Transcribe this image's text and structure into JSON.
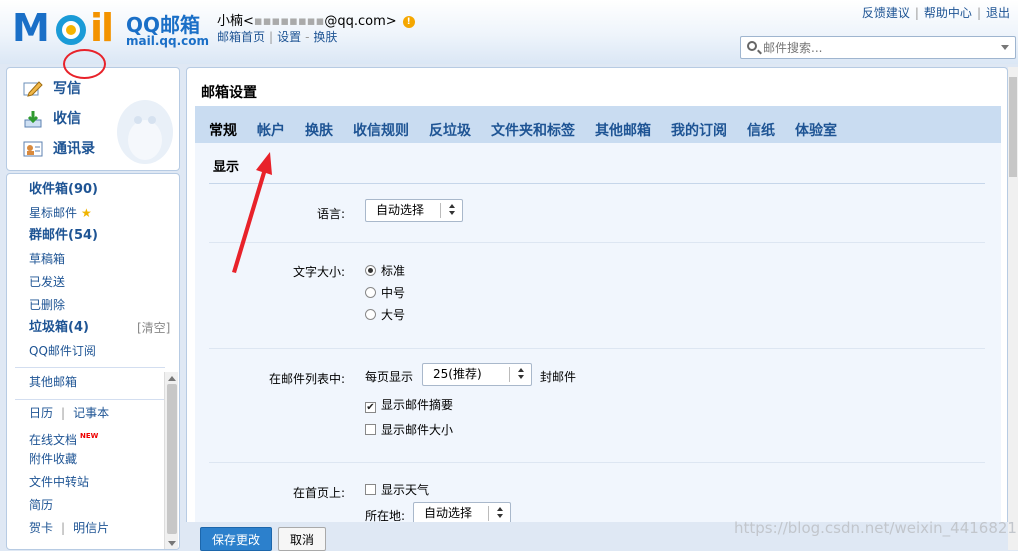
{
  "header": {
    "logo_cn": "QQ邮箱",
    "logo_url": "mail.qq.com",
    "user_name": "小楠<",
    "user_masked": "▪▪▪▪▪▪▪▪",
    "user_domain": "@qq.com>",
    "warn_glyph": "!",
    "links": [
      "邮箱首页",
      "设置",
      "换肤"
    ],
    "top_links": [
      "反馈建议",
      "帮助中心",
      "退出"
    ],
    "search_placeholder": "邮件搜索..."
  },
  "left_actions": [
    "写信",
    "收信",
    "通讯录"
  ],
  "folders": {
    "inbox": "收件箱(90)",
    "starred": "星标邮件",
    "group": "群邮件(54)",
    "drafts": "草稿箱",
    "sent": "已发送",
    "deleted": "已删除",
    "spam": "垃圾箱(4)",
    "clear": "[清空]",
    "subscribe": "QQ邮件订阅",
    "other": "其他邮箱",
    "calendar": "日历",
    "notes": "记事本",
    "online_docs": "在线文档",
    "new_badge": "NEW",
    "attachments": "附件收藏",
    "transfer": "文件中转站",
    "resume": "简历",
    "cards": "贺卡",
    "postcards": "明信片"
  },
  "main": {
    "title": "邮箱设置",
    "tabs": [
      "常规",
      "帐户",
      "换肤",
      "收信规则",
      "反垃圾",
      "文件夹和标签",
      "其他邮箱",
      "我的订阅",
      "信纸",
      "体验室"
    ],
    "active_tab": "常规",
    "section": "显示",
    "language_label": "语言:",
    "language_value": "自动选择",
    "font_size_label": "文字大小:",
    "font_sizes": [
      "标准",
      "中号",
      "大号"
    ],
    "font_size_selected": "标准",
    "list_label": "在邮件列表中:",
    "per_page_prefix": "每页显示",
    "per_page_value": "25(推荐)",
    "per_page_suffix": "封邮件",
    "show_summary": "显示邮件摘要",
    "show_summary_checked": true,
    "show_size": "显示邮件大小",
    "show_size_checked": false,
    "home_label": "在首页上:",
    "show_weather": "显示天气",
    "location_label": "所在地:",
    "location_value": "自动选择"
  },
  "buttons": {
    "save": "保存更改",
    "cancel": "取消"
  },
  "watermark": "https://blog.csdn.net/weixin_44168217",
  "colors": {
    "accent": "#1e5494",
    "tab_bar": "#c9dcf1",
    "annotation": "#e8222a",
    "save": "#2c80cc"
  }
}
